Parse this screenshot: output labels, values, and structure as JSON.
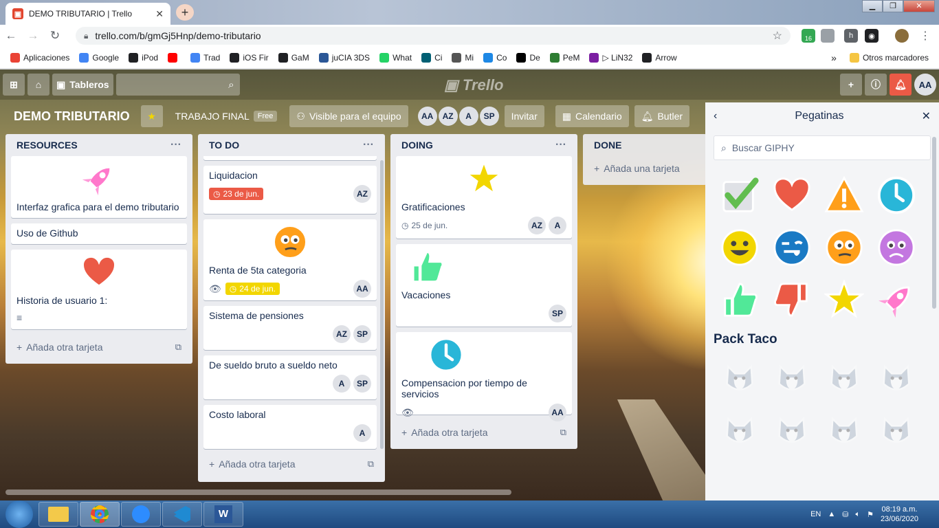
{
  "browser": {
    "tab_title": "DEMO TRIBUTARIO | Trello",
    "url": "trello.com/b/gmGj5Hnp/demo-tributario",
    "ext_badge": "16",
    "bookmarks": [
      {
        "label": "Aplicaciones",
        "icon": "apps-grid-icon",
        "color": "#ea4335"
      },
      {
        "label": "Google",
        "icon": "google-g-icon",
        "color": "#4285f4"
      },
      {
        "label": "iPod",
        "icon": "globe-icon",
        "color": "#202124"
      },
      {
        "label": "",
        "icon": "youtube-icon",
        "color": "#ff0000"
      },
      {
        "label": "Trad",
        "icon": "translate-icon",
        "color": "#4285f4"
      },
      {
        "label": "iOS Fir",
        "icon": "globe-icon",
        "color": "#202124"
      },
      {
        "label": "GaM",
        "icon": "gam-icon",
        "color": "#202124"
      },
      {
        "label": "juCIA 3DS",
        "icon": "game-icon",
        "color": "#2b5797"
      },
      {
        "label": "What",
        "icon": "whatsapp-icon",
        "color": "#25d366"
      },
      {
        "label": "Ci",
        "icon": "c-icon",
        "color": "#005f73"
      },
      {
        "label": "Mi",
        "icon": "signal-icon",
        "color": "#555"
      },
      {
        "label": "Co",
        "icon": "tv-icon",
        "color": "#1e88e5"
      },
      {
        "label": "De",
        "icon": "dc-icon",
        "color": "#000"
      },
      {
        "label": "PeM",
        "icon": "pem-icon",
        "color": "#2e7d32"
      },
      {
        "label": "▷ LiN32",
        "icon": "lin-icon",
        "color": "#7b1fa2"
      },
      {
        "label": "Arrow",
        "icon": "arrow-icon",
        "color": "#202124"
      }
    ],
    "bookmarks_more": "»",
    "other_bookmarks": "Otros marcadores"
  },
  "trello": {
    "boards_label": "Tableros",
    "logo": "Trello",
    "board_name": "DEMO TRIBUTARIO",
    "team_label": "TRABAJO FINAL",
    "team_badge": "Free",
    "visibility": "Visible para el equipo",
    "members": [
      "AA",
      "AZ",
      "A",
      "SP"
    ],
    "invite": "Invitar",
    "calendar": "Calendario",
    "butler": "Butler",
    "me": "AA"
  },
  "lists": [
    {
      "title": "RESOURCES",
      "add_label": "Añada otra tarjeta",
      "cards": [
        {
          "title": "Interfaz grafica para el demo tributario",
          "sticker": "rocket"
        },
        {
          "title": "Uso de Github"
        },
        {
          "title": "Historia de usuario 1:",
          "sticker": "heart",
          "has_description": true
        }
      ]
    },
    {
      "title": "TO DO",
      "add_label": "Añada otra tarjeta",
      "cards": [
        {
          "title": "Liquidacion",
          "due": "23 de jun.",
          "due_color": "#eb5a46",
          "members": [
            "AZ"
          ]
        },
        {
          "title": "Renta de 5ta categoria",
          "sticker": "thinking-face",
          "watch": true,
          "due": "24 de jun.",
          "due_color": "#f2d600",
          "members": [
            "AA"
          ]
        },
        {
          "title": "Sistema de pensiones",
          "members": [
            "AZ",
            "SP"
          ]
        },
        {
          "title": "De sueldo bruto a sueldo neto",
          "members": [
            "A",
            "SP"
          ]
        },
        {
          "title": "Costo laboral",
          "members": [
            "A"
          ]
        }
      ]
    },
    {
      "title": "DOING",
      "add_label": "Añada otra tarjeta",
      "cards": [
        {
          "title": "Gratificaciones",
          "sticker": "star",
          "due": "25 de jun.",
          "members": [
            "AZ",
            "A"
          ]
        },
        {
          "title": "Vacaciones",
          "sticker": "thumbs-up",
          "members": [
            "SP"
          ]
        },
        {
          "title": "Compensacion por tiempo de servicios",
          "sticker": "clock",
          "watch": true,
          "members": [
            "AA"
          ]
        }
      ]
    },
    {
      "title": "DONE",
      "add_label": "Añada una tarjeta"
    }
  ],
  "stickers_panel": {
    "title": "Pegatinas",
    "search_placeholder": "Buscar GIPHY",
    "pack_title": "Pack Taco",
    "stickers": [
      "check",
      "heart",
      "warning",
      "clock",
      "smile",
      "tongue",
      "thinking-face",
      "frown",
      "thumbs-up",
      "thumbs-down",
      "star",
      "rocket"
    ]
  },
  "taskbar": {
    "lang": "EN",
    "time": "08:19 a.m.",
    "date": "23/06/2020"
  },
  "colors": {
    "trello_list_bg": "#ebecf0",
    "due_red": "#eb5a46",
    "due_yellow": "#f2d600",
    "heart": "#eb5a46",
    "check": "#61bd4f",
    "clock": "#29b6d8"
  }
}
